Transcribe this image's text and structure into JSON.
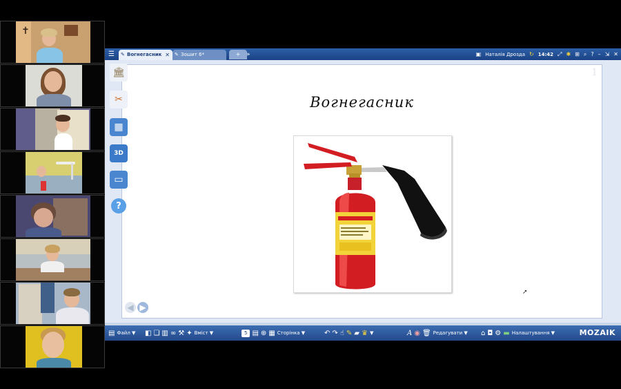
{
  "titlebar": {
    "tabs": [
      {
        "label": "Вогнегасник",
        "active": true
      },
      {
        "label": "Зошит 6*",
        "active": false
      }
    ],
    "more": "»",
    "user": "Наталія Дрозда",
    "clock": "14:42"
  },
  "page": {
    "number": "1",
    "title": "Вогнегасник"
  },
  "toolbar": {
    "file_label": "Файл ▼",
    "insert_label": "Вміст ▼",
    "page_value": "5",
    "page_label": "Сторінка ▼",
    "edit_label": "Редагувати ▼",
    "settings_label": "Налаштування ▼",
    "brand": "MOZAIK"
  },
  "colors": {
    "titlebar": "#1c4386",
    "extinguisher_red": "#d21d23",
    "label_yellow": "#f2d33a"
  },
  "icons": [
    "menu-icon",
    "pen-icon",
    "close-icon",
    "screenshot-icon",
    "refresh-icon",
    "search-icon",
    "help-icon",
    "minimize-icon",
    "restore-icon",
    "close-window-icon",
    "museum-icon",
    "tools-icon",
    "gallery-icon",
    "3d-icon",
    "presentation-icon",
    "help-circle-icon"
  ]
}
